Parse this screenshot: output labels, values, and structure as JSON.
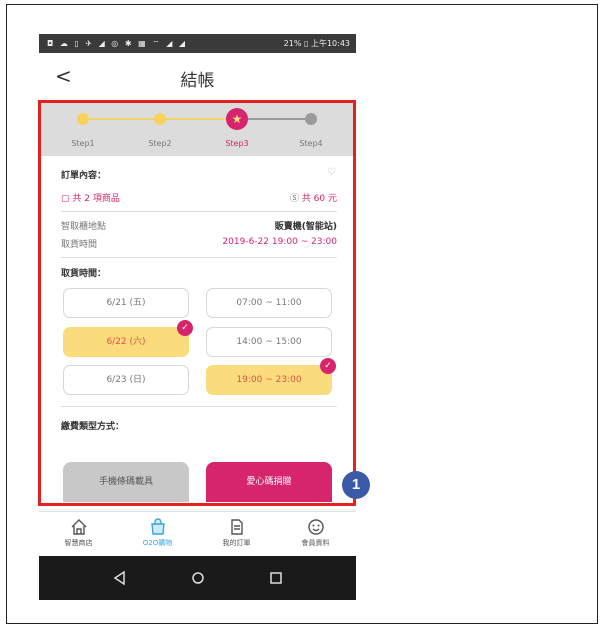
{
  "statusbar": {
    "left_icons": "◘ ☁ ▯ ✈ ◢  ◎ ✱ ▦ ⌔ ◢ ◢",
    "right_text": "21% ▯ 上午10:43"
  },
  "header": {
    "back_icon": "chevron-left-icon",
    "back": "<",
    "title": "結帳"
  },
  "steps": [
    {
      "label": "Step1",
      "state": "done"
    },
    {
      "label": "Step2",
      "state": "done"
    },
    {
      "label": "Step3",
      "state": "current",
      "icon": "star-icon"
    },
    {
      "label": "Step4",
      "state": "todo"
    }
  ],
  "order": {
    "section_title": "訂單內容：",
    "heart_icon": "heart-outline-icon",
    "items_icon": "bag-icon",
    "items_text": "共 2 項商品",
    "amount_icon": "dollar-circle-icon",
    "amount_text": "共 60 元",
    "pickup_location_label": "智取櫃地點",
    "pickup_location_value": "販賣機(智能站)",
    "pickup_time_label": "取貨時間",
    "pickup_time_value": "2019-6-22 19:00 ~ 23:00"
  },
  "pickup": {
    "section_title": "取貨時間：",
    "dates": [
      {
        "label": "6/21 (五)",
        "selected": false
      },
      {
        "label": "6/22 (六)",
        "selected": true
      },
      {
        "label": "6/23 (日)",
        "selected": false
      }
    ],
    "times": [
      {
        "label": "07:00 ~ 11:00",
        "selected": false
      },
      {
        "label": "14:00 ~ 15:00",
        "selected": false
      },
      {
        "label": "19:00 ~ 23:00",
        "selected": true
      }
    ],
    "check": "✓"
  },
  "payment": {
    "section_title": "繳費類型方式：",
    "option_a": "手機條碼載具",
    "option_b": "愛心碼捐贈"
  },
  "annotation": {
    "badge": "1"
  },
  "tabbar": [
    {
      "label": "智慧商店",
      "icon": "home-icon",
      "active": false
    },
    {
      "label": "O2O購物",
      "icon": "shopping-bag-icon",
      "active": true
    },
    {
      "label": "我的訂單",
      "icon": "document-icon",
      "active": false
    },
    {
      "label": "會員資料",
      "icon": "smiley-icon",
      "active": false
    }
  ],
  "navbar": {
    "back_icon": "nav-back-icon",
    "home_icon": "nav-home-icon",
    "recent_icon": "nav-recent-icon"
  },
  "colors": {
    "accent": "#d6246d",
    "selected": "#fbdc7c",
    "highlight": "#e52020",
    "badge": "#3a5aa8",
    "tab_active": "#3aa3e0"
  }
}
